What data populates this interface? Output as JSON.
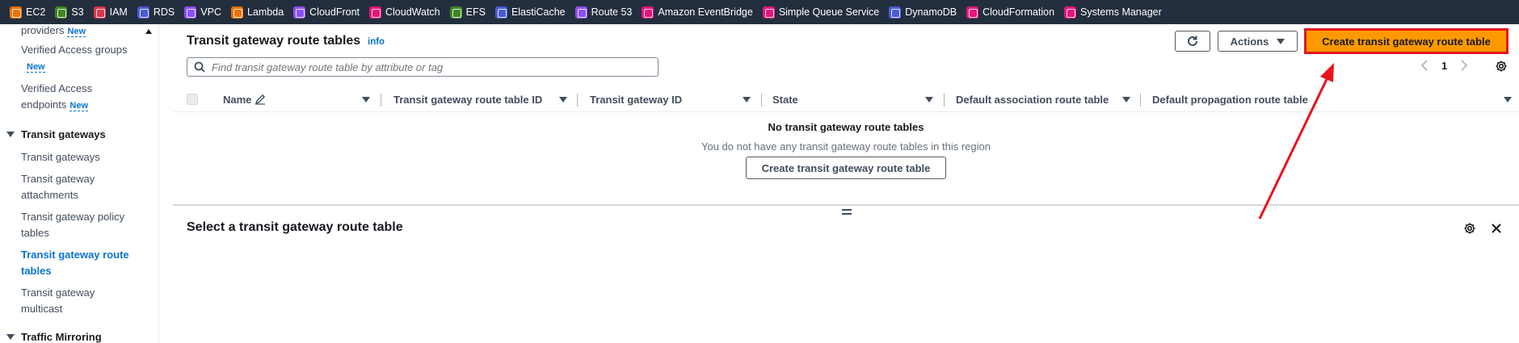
{
  "favorites": [
    {
      "label": "EC2",
      "color": "#ed7100",
      "icon": "ec2-icon"
    },
    {
      "label": "S3",
      "color": "#3f8624",
      "icon": "s3-icon"
    },
    {
      "label": "IAM",
      "color": "#dd344c",
      "icon": "iam-icon"
    },
    {
      "label": "RDS",
      "color": "#4a5bd6",
      "icon": "rds-icon"
    },
    {
      "label": "VPC",
      "color": "#8c4fff",
      "icon": "vpc-icon"
    },
    {
      "label": "Lambda",
      "color": "#ed7100",
      "icon": "lambda-icon"
    },
    {
      "label": "CloudFront",
      "color": "#8c4fff",
      "icon": "cloudfront-icon"
    },
    {
      "label": "CloudWatch",
      "color": "#e7157b",
      "icon": "cloudwatch-icon"
    },
    {
      "label": "EFS",
      "color": "#3f8624",
      "icon": "efs-icon"
    },
    {
      "label": "ElastiCache",
      "color": "#4a5bd6",
      "icon": "elasticache-icon"
    },
    {
      "label": "Route 53",
      "color": "#8c4fff",
      "icon": "route53-icon"
    },
    {
      "label": "Amazon EventBridge",
      "color": "#e7157b",
      "icon": "eventbridge-icon"
    },
    {
      "label": "Simple Queue Service",
      "color": "#e7157b",
      "icon": "sqs-icon"
    },
    {
      "label": "DynamoDB",
      "color": "#4a5bd6",
      "icon": "dynamodb-icon"
    },
    {
      "label": "CloudFormation",
      "color": "#e7157b",
      "icon": "cloudformation-icon"
    },
    {
      "label": "Systems Manager",
      "color": "#e7157b",
      "icon": "systems-manager-icon"
    }
  ],
  "sidebar": {
    "items_top": [
      {
        "label": "providers",
        "badge": "New"
      },
      {
        "label": "Verified Access groups",
        "badge": "New"
      },
      {
        "label": "Verified Access endpoints",
        "badge": "New"
      }
    ],
    "section_transit": "Transit gateways",
    "transit_items": [
      {
        "label": "Transit gateways"
      },
      {
        "label": "Transit gateway attachments"
      },
      {
        "label": "Transit gateway policy tables"
      },
      {
        "label": "Transit gateway route tables"
      },
      {
        "label": "Transit gateway multicast"
      }
    ],
    "section_mirroring": "Traffic Mirroring"
  },
  "main": {
    "title": "Transit gateway route tables",
    "info": "info",
    "actions_label": "Actions",
    "create_label": "Create transit gateway route table",
    "search_placeholder": "Find transit gateway route table by attribute or tag",
    "page": "1",
    "columns": [
      "Name",
      "Transit gateway route table ID",
      "Transit gateway ID",
      "State",
      "Default association route table",
      "Default propagation route table"
    ],
    "empty_title": "No transit gateway route tables",
    "empty_desc": "You do not have any transit gateway route tables in this region",
    "empty_button": "Create transit gateway route table"
  },
  "split_panel": {
    "title": "Select a transit gateway route table"
  },
  "colors": {
    "primary_button": "#ff9900",
    "highlight_border": "#e8141d",
    "annotation_arrow": "#e8141d",
    "link": "#0972d3",
    "nav_bar": "#232f3e"
  }
}
